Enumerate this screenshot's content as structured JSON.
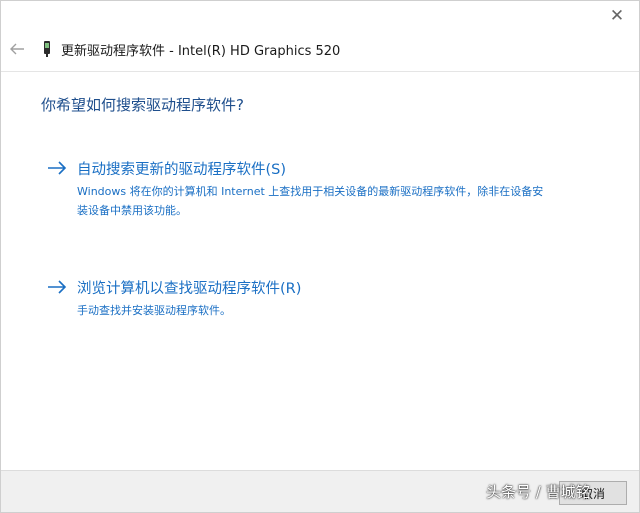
{
  "window": {
    "title": "更新驱动程序软件 - Intel(R) HD Graphics 520",
    "close_glyph": "✕"
  },
  "main": {
    "question": "你希望如何搜索驱动程序软件?",
    "options": [
      {
        "title": "自动搜索更新的驱动程序软件(S)",
        "description": "Windows 将在你的计算机和 Internet 上查找用于相关设备的最新驱动程序软件，除非在设备安装设备中禁用该功能。"
      },
      {
        "title": "浏览计算机以查找驱动程序软件(R)",
        "description": "手动查找并安装驱动程序软件。"
      }
    ]
  },
  "footer": {
    "cancel_label": "取消"
  },
  "watermark": {
    "text": "头条号 / 曹城铭"
  },
  "colors": {
    "link": "#1a6fc4",
    "heading": "#1e4e8c",
    "footer_bg": "#f0f0f0"
  },
  "icons": {
    "back": "back-arrow-icon",
    "device": "device-icon",
    "option_arrow": "right-arrow-icon",
    "close": "close-icon"
  }
}
